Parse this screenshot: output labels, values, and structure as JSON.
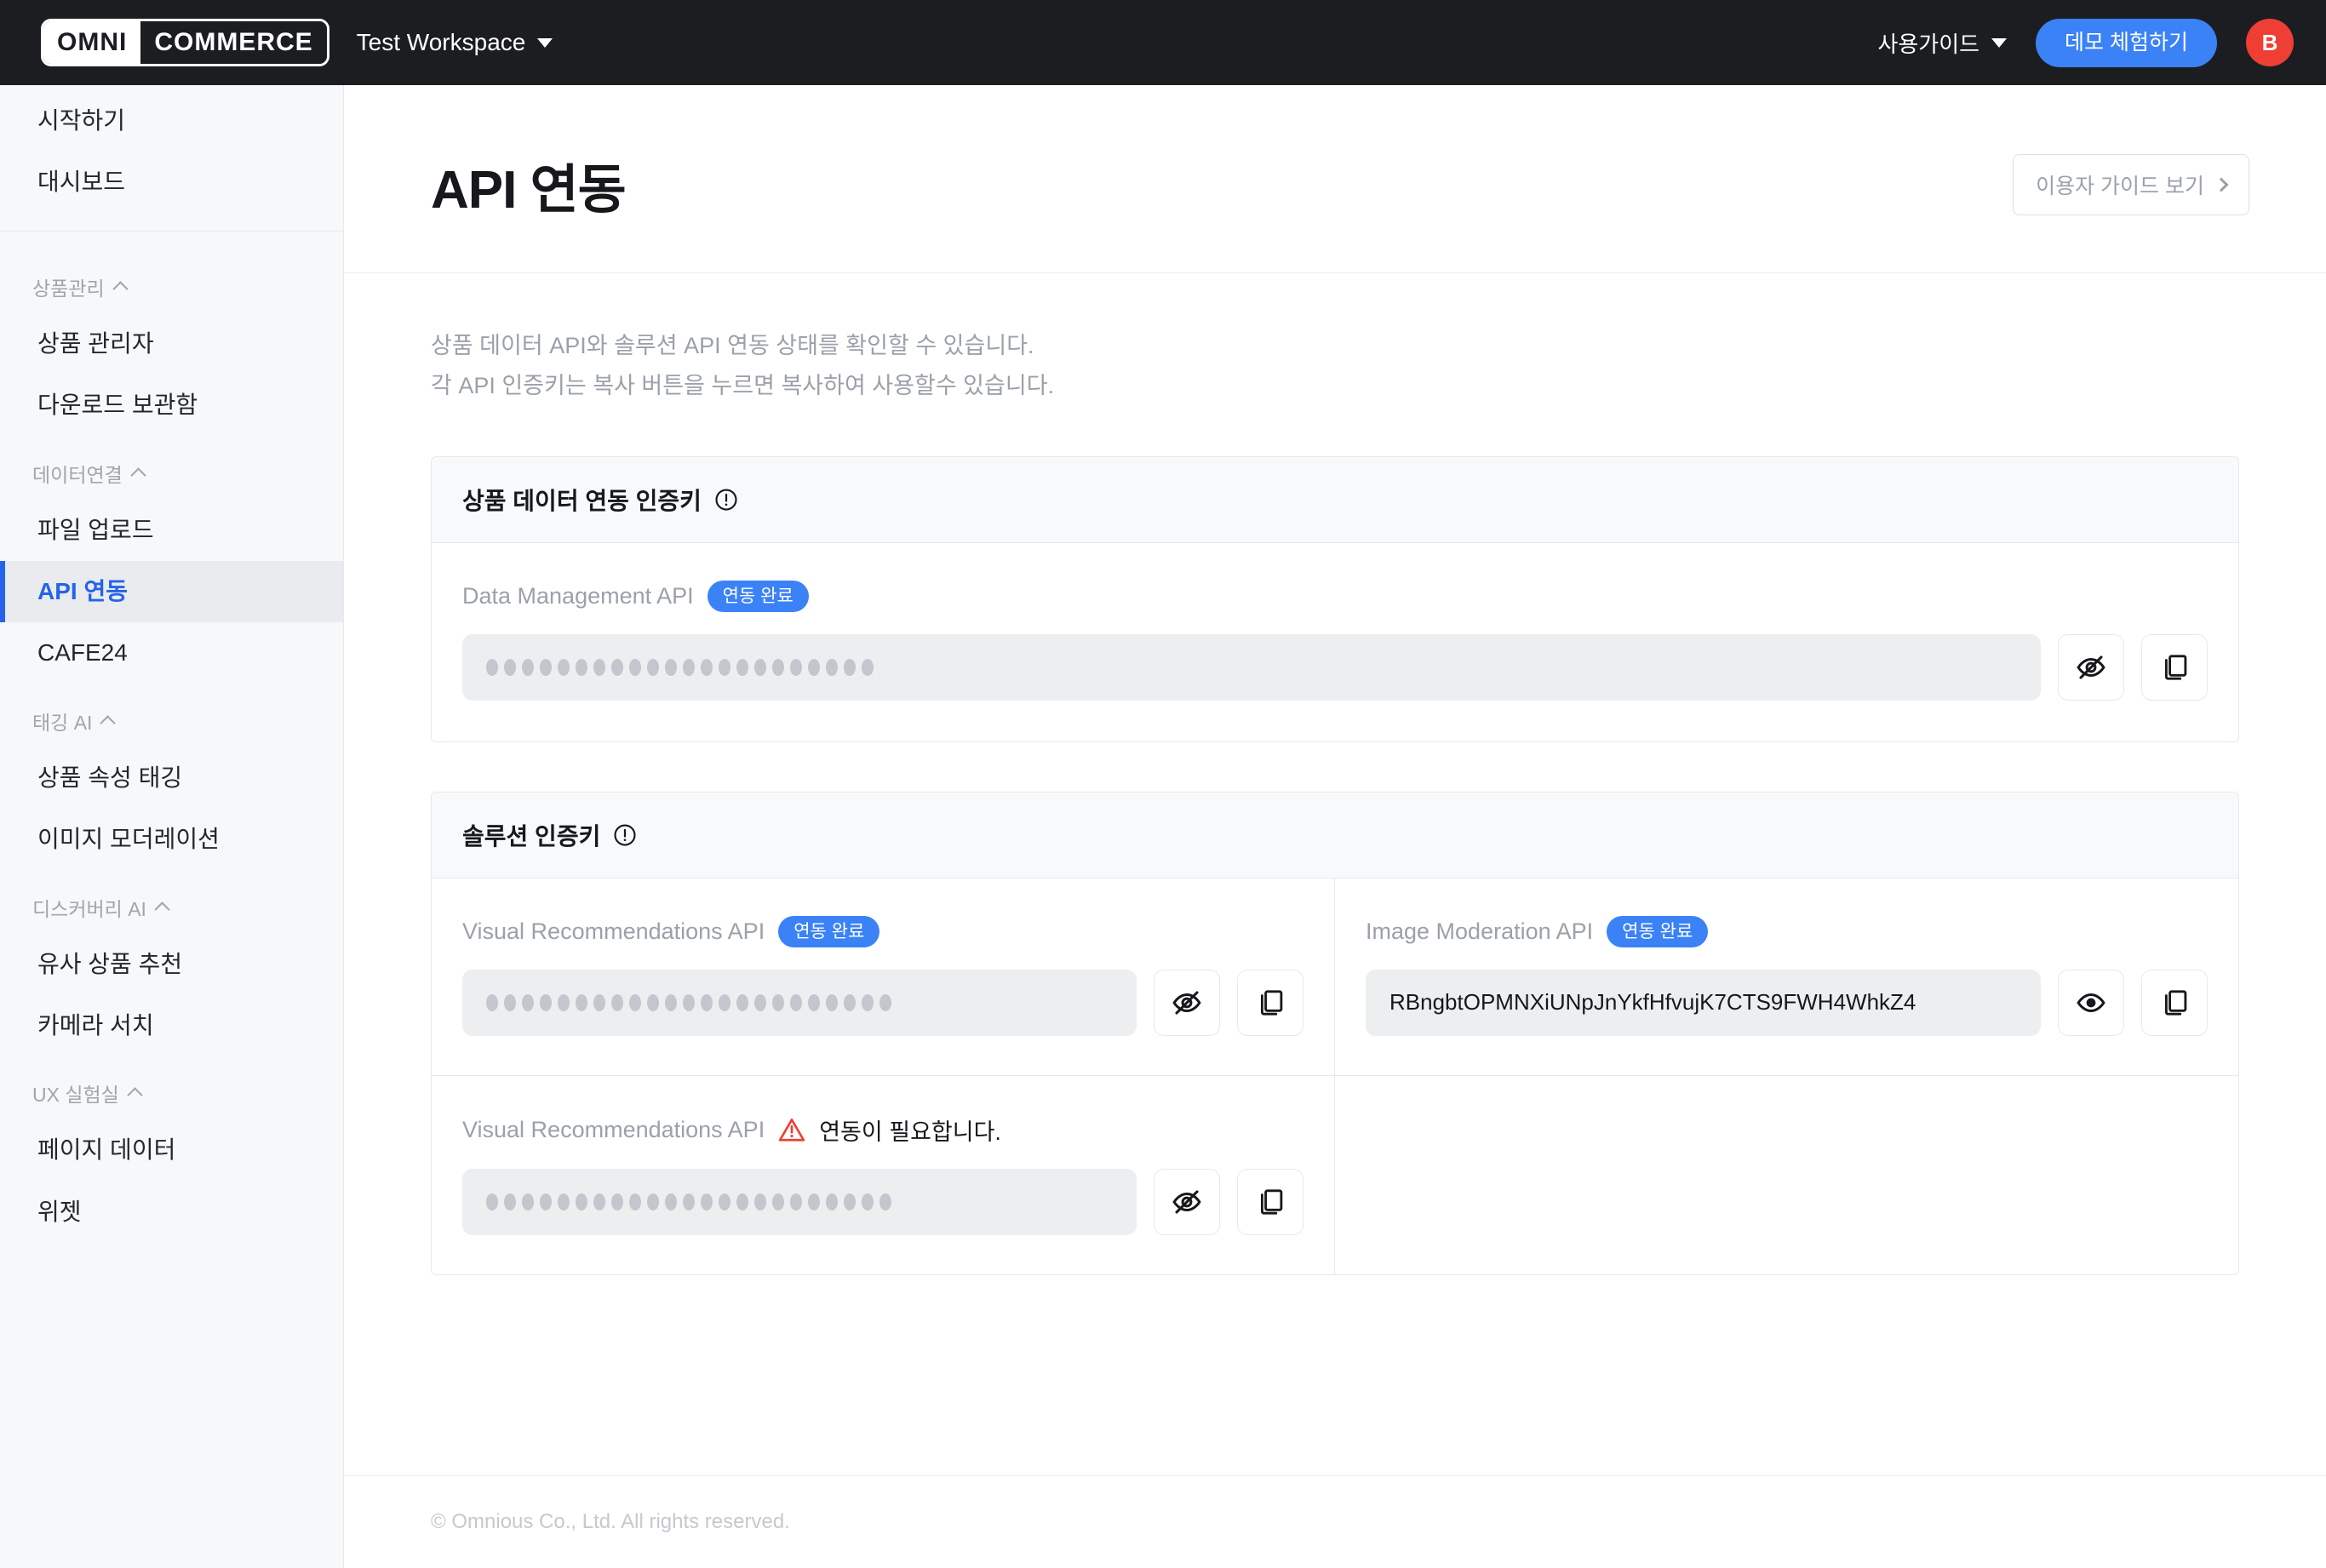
{
  "topbar": {
    "logo_left": "OMNI",
    "logo_right": "COMMERCE",
    "workspace": "Test Workspace",
    "guide_menu": "사용가이드",
    "demo_button": "데모 체험하기",
    "avatar_initial": "B",
    "accent_blue": "#3b82f6",
    "avatar_color": "#ef3e33",
    "background": "#1b1d21"
  },
  "sidebar": {
    "top_items": [
      {
        "label": "시작하기",
        "active": false
      },
      {
        "label": "대시보드",
        "active": false
      }
    ],
    "groups": [
      {
        "title": "상품관리",
        "items": [
          {
            "label": "상품 관리자",
            "active": false
          },
          {
            "label": "다운로드 보관함",
            "active": false
          }
        ]
      },
      {
        "title": "데이터연결",
        "items": [
          {
            "label": "파일 업로드",
            "active": false
          },
          {
            "label": "API 연동",
            "active": true
          },
          {
            "label": "CAFE24",
            "active": false
          }
        ]
      },
      {
        "title": "태깅 AI",
        "items": [
          {
            "label": "상품 속성 태깅",
            "active": false
          },
          {
            "label": "이미지 모더레이션",
            "active": false
          }
        ]
      },
      {
        "title": "디스커버리 AI",
        "items": [
          {
            "label": "유사 상품 추천",
            "active": false
          },
          {
            "label": "카메라 서치",
            "active": false
          }
        ]
      },
      {
        "title": "UX 실험실",
        "items": [
          {
            "label": "페이지 데이터",
            "active": false
          },
          {
            "label": "위젯",
            "active": false
          }
        ]
      }
    ],
    "active_color": "#2563eb"
  },
  "page": {
    "title": "API 연동",
    "guide_button": "이용자 가이드 보기",
    "description_line1": "상품 데이터 API와 솔루션 API 연동 상태를 확인할 수 있습니다.",
    "description_line2": "각 API 인증키는 복사 버튼을 누르면 복사하여 사용할수 있습니다."
  },
  "cards": [
    {
      "header": "상품 데이터 연동 인증키",
      "rows": [
        {
          "api_name": "Data Management API",
          "status": "연동 완료",
          "status_type": "ok",
          "masked": true,
          "key_value": "",
          "dot_count": 22,
          "reveal_icon": "eye-off-icon",
          "copy_icon": "copy-icon"
        }
      ]
    },
    {
      "header": "솔루션 인증키",
      "rows": [
        {
          "api_name": "Visual Recommendations API",
          "status": "연동 완료",
          "status_type": "ok",
          "masked": true,
          "key_value": "",
          "dot_count": 23,
          "reveal_icon": "eye-off-icon",
          "copy_icon": "copy-icon"
        },
        {
          "api_name": "Image Moderation API",
          "status": "연동 완료",
          "status_type": "ok",
          "masked": false,
          "key_value": "RBngbtOPMNXiUNpJnYkfHfvujK7CTS9FWH4WhkZ4",
          "dot_count": 0,
          "reveal_icon": "eye-icon",
          "copy_icon": "copy-icon"
        },
        {
          "api_name": "Visual Recommendations API",
          "status": "연동이 필요합니다.",
          "status_type": "warning",
          "masked": true,
          "key_value": "",
          "dot_count": 23,
          "reveal_icon": "eye-off-icon",
          "copy_icon": "copy-icon"
        }
      ]
    }
  ],
  "footer": {
    "copyright": "© Omnious Co., Ltd. All rights reserved."
  }
}
